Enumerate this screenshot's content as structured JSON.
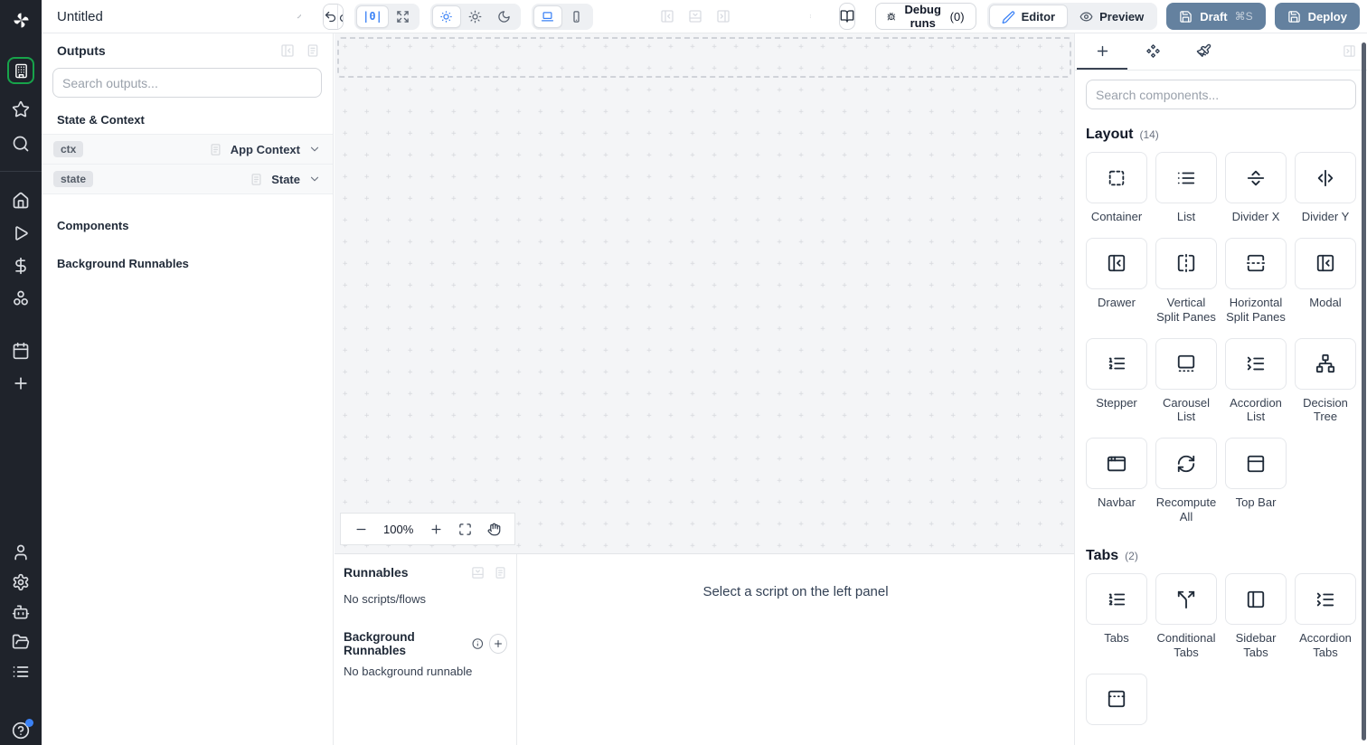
{
  "topbar": {
    "title": "Untitled",
    "zoom_reset_label": "|0|",
    "debug_runs_label": "Debug runs",
    "debug_runs_count": "(0)",
    "editor_label": "Editor",
    "preview_label": "Preview",
    "draft_label": "Draft",
    "draft_shortcut": "⌘S",
    "deploy_label": "Deploy"
  },
  "left_rail": {
    "sections": [
      {
        "items": [
          {
            "icon": "building",
            "selected": true
          },
          {
            "icon": "star"
          },
          {
            "icon": "search"
          }
        ]
      },
      {
        "items": [
          {
            "icon": "home"
          },
          {
            "icon": "play"
          },
          {
            "icon": "dollar-sign"
          },
          {
            "icon": "resources"
          },
          {
            "icon": "calendar",
            "gap_before": "mid"
          },
          {
            "icon": "plus"
          }
        ]
      },
      {
        "items": [
          {
            "icon": "user"
          },
          {
            "icon": "settings"
          },
          {
            "icon": "bot"
          },
          {
            "icon": "folder-open"
          },
          {
            "icon": "list"
          },
          {
            "icon": "help",
            "badge": true,
            "gap_before": "big"
          }
        ]
      }
    ]
  },
  "outputs_panel": {
    "title": "Outputs",
    "search_placeholder": "Search outputs...",
    "section_state_context": "State & Context",
    "rows": [
      {
        "badge": "ctx",
        "label": "App Context"
      },
      {
        "badge": "state",
        "label": "State"
      }
    ],
    "section_components": "Components",
    "section_background": "Background Runnables"
  },
  "canvas": {
    "zoom_level": "100%"
  },
  "runnables": {
    "title": "Runnables",
    "empty": "No scripts/flows",
    "background_title": "Background Runnables",
    "background_empty": "No background runnable",
    "placeholder": "Select a script on the left panel"
  },
  "components_panel": {
    "search_placeholder": "Search components...",
    "sections": [
      {
        "title": "Layout",
        "count": "(14)",
        "items": [
          {
            "label": "Container",
            "icon": "box-select"
          },
          {
            "label": "List",
            "icon": "list"
          },
          {
            "label": "Divider X",
            "icon": "separator-horizontal"
          },
          {
            "label": "Divider Y",
            "icon": "separator-vertical"
          },
          {
            "label": "Drawer",
            "icon": "panel-left-close"
          },
          {
            "label": "Vertical Split Panes",
            "icon": "flip-horizontal"
          },
          {
            "label": "Horizontal Split Panes",
            "icon": "flip-vertical"
          },
          {
            "label": "Modal",
            "icon": "panel-left-close"
          },
          {
            "label": "Stepper",
            "icon": "list-ordered"
          },
          {
            "label": "Carousel List",
            "icon": "gallery-thumbnails"
          },
          {
            "label": "Accordion List",
            "icon": "list-collapse"
          },
          {
            "label": "Decision Tree",
            "icon": "network"
          },
          {
            "label": "Navbar",
            "icon": "app-window"
          },
          {
            "label": "Recompute All",
            "icon": "refresh-cw"
          },
          {
            "label": "Top Bar",
            "icon": "panel-top"
          }
        ]
      },
      {
        "title": "Tabs",
        "count": "(2)",
        "items": [
          {
            "label": "Tabs",
            "icon": "list-ordered"
          },
          {
            "label": "Conditional Tabs",
            "icon": "split"
          },
          {
            "label": "Sidebar Tabs",
            "icon": "panel-left"
          },
          {
            "label": "Accordion Tabs",
            "icon": "list-collapse"
          },
          {
            "label": "",
            "icon": "panel-top-dashed"
          }
        ]
      }
    ]
  },
  "colors": {
    "accent_blue": "#3b82f6",
    "selected_green": "#17a34a",
    "primary_button": "#64819f",
    "sidebar_bg": "#1f232b",
    "canvas_bg": "#f4f5f7"
  }
}
